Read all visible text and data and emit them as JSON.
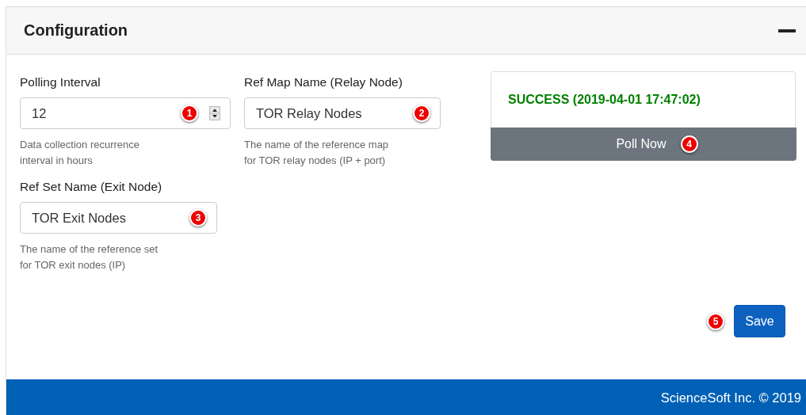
{
  "panel": {
    "title": "Configuration",
    "expanded": true
  },
  "fields": [
    {
      "kind": "number",
      "label": "Polling Interval",
      "value": "12",
      "badge": "1",
      "hint": "Data collection recurrence\ninterval in hours"
    },
    {
      "kind": "text",
      "label": "Ref Map Name (Relay Node)",
      "value": "TOR Relay Nodes",
      "badge": "2",
      "hint": "The name of the reference map\nfor TOR relay nodes (IP + port)"
    },
    {
      "kind": "text",
      "label": "Ref Set Name (Exit Node)",
      "value": "TOR Exit Nodes",
      "badge": "3",
      "hint": "The name of the reference set\nfor TOR exit nodes (IP)"
    }
  ],
  "status": {
    "message": "SUCCESS (2019-04-01 17:47:02)",
    "color": "#008000",
    "button": "Poll Now",
    "badge": "4"
  },
  "save": {
    "label": "Save",
    "badge": "5"
  },
  "footer": "ScienceSoft Inc. © 2019"
}
